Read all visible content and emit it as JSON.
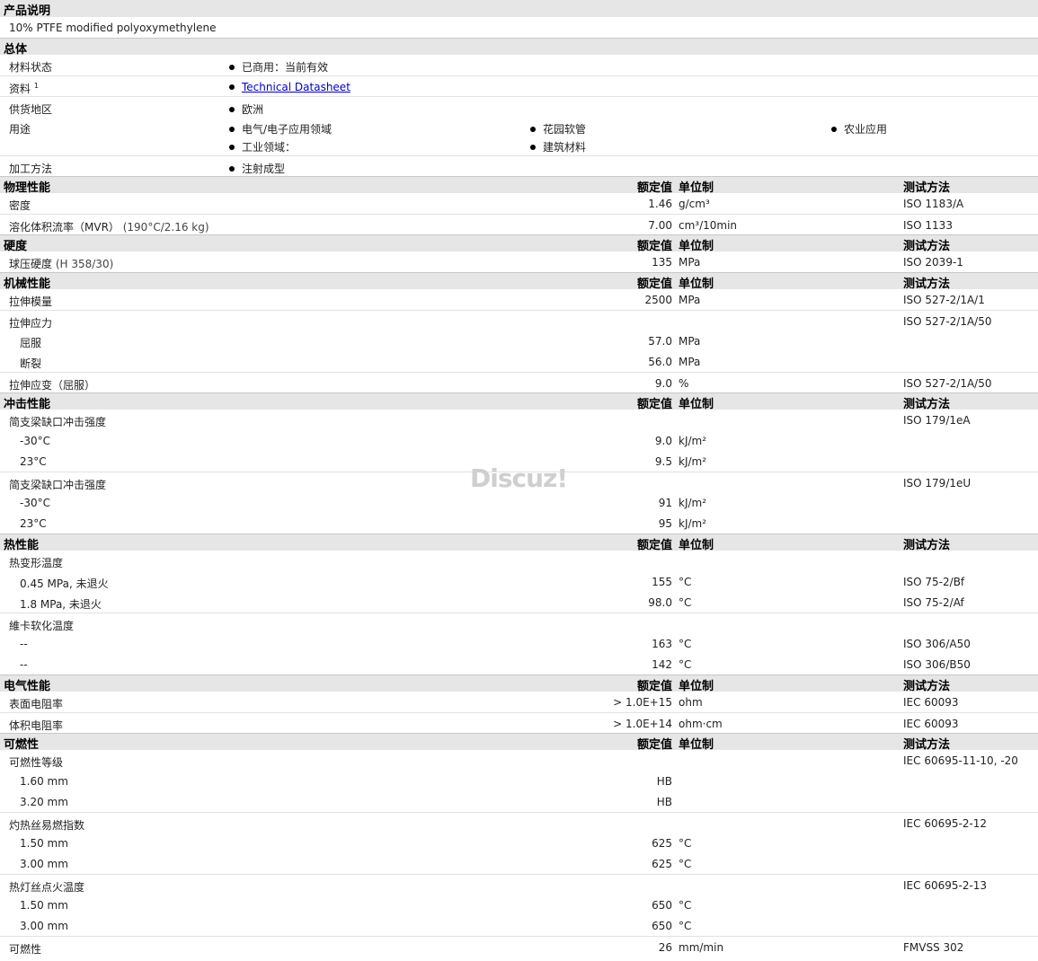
{
  "sections": {
    "product": {
      "title": "产品说明",
      "desc": "10% PTFE modified polyoxymethylene"
    },
    "general": {
      "title": "总体",
      "material_status": {
        "label": "材料状态",
        "value": "已商用：当前有效"
      },
      "document": {
        "label": "资料",
        "sup": "1",
        "value": "Technical Datasheet"
      },
      "region": {
        "label": "供货地区",
        "value": "欧洲"
      },
      "uses": {
        "label": "用途",
        "items": [
          "电气/电子应用领域",
          "花园软管",
          "农业应用",
          "工业领域：",
          "建筑材料"
        ]
      },
      "processing": {
        "label": "加工方法",
        "value": "注射成型"
      }
    },
    "col_value": "额定值",
    "col_unit": "单位制",
    "col_method": "测试方法",
    "physical": {
      "title": "物理性能",
      "rows": [
        {
          "label": "密度",
          "cond": "",
          "value": "1.46",
          "unit": "g/cm³",
          "method": "ISO 1183/A"
        },
        {
          "label": "溶化体积流率（MVR）",
          "cond": "(190°C/2.16 kg)",
          "value": "7.00",
          "unit": "cm³/10min",
          "method": "ISO 1133"
        }
      ]
    },
    "hardness": {
      "title": "硬度",
      "rows": [
        {
          "label": "球压硬度",
          "cond": "(H 358/30)",
          "value": "135",
          "unit": "MPa",
          "method": "ISO 2039-1"
        }
      ]
    },
    "mechanical": {
      "title": "机械性能",
      "rows": [
        {
          "label": "拉伸模量",
          "value": "2500",
          "unit": "MPa",
          "method": "ISO 527-2/1A/1"
        },
        {
          "label": "拉伸应力",
          "value": "",
          "unit": "",
          "method": "ISO 527-2/1A/50"
        },
        {
          "label": "屈服",
          "value": "57.0",
          "unit": "MPa",
          "method": ""
        },
        {
          "label": "断裂",
          "value": "56.0",
          "unit": "MPa",
          "method": ""
        },
        {
          "label": "拉伸应变（屈服）",
          "value": "9.0",
          "unit": "%",
          "method": "ISO 527-2/1A/50"
        }
      ]
    },
    "impact": {
      "title": "冲击性能",
      "rows": [
        {
          "label": "简支梁缺口冲击强度",
          "value": "",
          "unit": "",
          "method": "ISO 179/1eA"
        },
        {
          "label": "-30°C",
          "value": "9.0",
          "unit": "kJ/m²",
          "method": ""
        },
        {
          "label": "23°C",
          "value": "9.5",
          "unit": "kJ/m²",
          "method": ""
        },
        {
          "label": "简支梁缺口冲击强度",
          "value": "",
          "unit": "",
          "method": "ISO 179/1eU"
        },
        {
          "label": "-30°C",
          "value": "91",
          "unit": "kJ/m²",
          "method": ""
        },
        {
          "label": "23°C",
          "value": "95",
          "unit": "kJ/m²",
          "method": ""
        }
      ]
    },
    "thermal": {
      "title": "热性能",
      "rows": [
        {
          "label": "热变形温度",
          "value": "",
          "unit": "",
          "method": ""
        },
        {
          "label": "0.45 MPa, 未退火",
          "value": "155",
          "unit": "°C",
          "method": "ISO 75-2/Bf"
        },
        {
          "label": "1.8 MPa, 未退火",
          "value": "98.0",
          "unit": "°C",
          "method": "ISO 75-2/Af"
        },
        {
          "label": "維卡软化温度",
          "value": "",
          "unit": "",
          "method": ""
        },
        {
          "label": "--",
          "value": "163",
          "unit": "°C",
          "method": "ISO 306/A50"
        },
        {
          "label": "--",
          "value": "142",
          "unit": "°C",
          "method": "ISO 306/B50"
        }
      ]
    },
    "electrical": {
      "title": "电气性能",
      "rows": [
        {
          "label": "表面电阻率",
          "value": "> 1.0E+15",
          "unit": "ohm",
          "method": "IEC 60093"
        },
        {
          "label": "体积电阻率",
          "value": "> 1.0E+14",
          "unit": "ohm·cm",
          "method": "IEC 60093"
        }
      ]
    },
    "flammability": {
      "title": "可燃性",
      "rows": [
        {
          "label": "可燃性等级",
          "value": "",
          "unit": "",
          "method": "IEC 60695-11-10, -20"
        },
        {
          "label": "1.60 mm",
          "value": "HB",
          "unit": "",
          "method": ""
        },
        {
          "label": "3.20 mm",
          "value": "HB",
          "unit": "",
          "method": ""
        },
        {
          "label": "灼热丝易燃指数",
          "value": "",
          "unit": "",
          "method": "IEC 60695-2-12"
        },
        {
          "label": "1.50 mm",
          "value": "625",
          "unit": "°C",
          "method": ""
        },
        {
          "label": "3.00 mm",
          "value": "625",
          "unit": "°C",
          "method": ""
        },
        {
          "label": "热灯丝点火温度",
          "value": "",
          "unit": "",
          "method": "IEC 60695-2-13"
        },
        {
          "label": "1.50 mm",
          "value": "650",
          "unit": "°C",
          "method": ""
        },
        {
          "label": "3.00 mm",
          "value": "650",
          "unit": "°C",
          "method": ""
        },
        {
          "label": "可燃性",
          "value": "26",
          "unit": "mm/min",
          "method": "FMVSS 302"
        }
      ]
    }
  },
  "watermark": "Discuz!"
}
